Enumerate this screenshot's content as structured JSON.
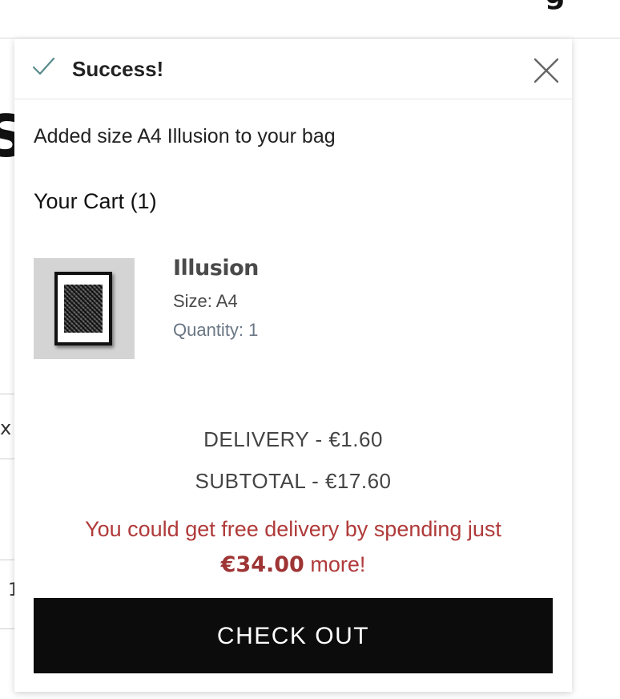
{
  "notification": {
    "title": "Success!",
    "icon": "checkmark-icon",
    "close_icon": "close-icon",
    "message": "Added size A4 Illusion to your bag"
  },
  "cart": {
    "heading": "Your Cart (1)",
    "item": {
      "name": "Illusion",
      "size": "Size: A4",
      "quantity": "Quantity: 1"
    },
    "delivery": "DELIVERY - €1.60",
    "subtotal": "SUBTOTAL - €17.60",
    "free_delivery": {
      "prefix": "You could get free delivery by spending just",
      "amount": "€34.00",
      "suffix": "more!"
    },
    "checkout_label": "CHECK OUT"
  },
  "colors": {
    "accent_red": "#b03a3a",
    "checkout_bg": "#0c0c0c",
    "check_icon": "#5a8a8a"
  }
}
